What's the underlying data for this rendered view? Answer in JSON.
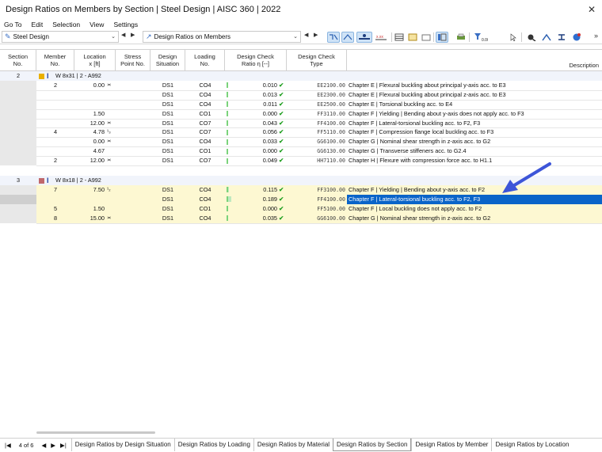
{
  "window": {
    "title": "Design Ratios on Members by Section | Steel Design | AISC 360 | 2022",
    "close": "✕"
  },
  "menu": [
    "Go To",
    "Edit",
    "Selection",
    "View",
    "Settings"
  ],
  "toolbar": {
    "module": "Steel Design",
    "table": "Design Ratios on Members",
    "more": "»"
  },
  "columns": {
    "section": [
      "Section",
      "No."
    ],
    "member": [
      "Member",
      "No."
    ],
    "location": [
      "Location",
      "x [ft]"
    ],
    "stress": [
      "Stress",
      "Point No."
    ],
    "situation": [
      "Design",
      "Situation"
    ],
    "loading": [
      "Loading",
      "No."
    ],
    "ratio": [
      "Design Check",
      "Ratio η [--]"
    ],
    "type": [
      "Design Check",
      "Type"
    ],
    "desc": "Description"
  },
  "groups": [
    {
      "section": "2",
      "color": "#e9b000",
      "name": "W 8x31 | 2 - A992",
      "rows": [
        {
          "member": "2",
          "loc": "0.00",
          "sym": "≍",
          "ds": "DS1",
          "lo": "CO4",
          "ratio": "0.010",
          "bar": 0.01,
          "type": "EE2100.00",
          "desc": "Chapter E | Flexural buckling about principal y-axis acc. to E3"
        },
        {
          "member": "",
          "loc": "",
          "sym": "",
          "ds": "DS1",
          "lo": "CO4",
          "ratio": "0.013",
          "bar": 0.013,
          "type": "EE2300.00",
          "desc": "Chapter E | Flexural buckling about principal z-axis acc. to E3"
        },
        {
          "member": "",
          "loc": "",
          "sym": "",
          "ds": "DS1",
          "lo": "CO4",
          "ratio": "0.011",
          "bar": 0.011,
          "type": "EE2500.00",
          "desc": "Chapter E | Torsional buckling acc. to E4"
        },
        {
          "member": "",
          "loc": "1.50",
          "sym": "",
          "ds": "DS1",
          "lo": "CO1",
          "ratio": "0.000",
          "bar": 0,
          "type": "FF3110.00",
          "desc": "Chapter F | Yielding | Bending about y-axis does not apply acc. to F3"
        },
        {
          "member": "",
          "loc": "12.00",
          "sym": "≍",
          "ds": "DS1",
          "lo": "CO7",
          "ratio": "0.043",
          "bar": 0.043,
          "type": "FF4100.00",
          "desc": "Chapter F | Lateral-torsional buckling acc. to F2, F3"
        },
        {
          "member": "4",
          "loc": "4.78",
          "sym": "¹₃",
          "ds": "DS1",
          "lo": "CO7",
          "ratio": "0.056",
          "bar": 0.056,
          "type": "FF5110.00",
          "desc": "Chapter F | Compression flange local buckling acc. to F3"
        },
        {
          "member": "",
          "loc": "0.00",
          "sym": "≍",
          "ds": "DS1",
          "lo": "CO4",
          "ratio": "0.033",
          "bar": 0.033,
          "type": "GG6100.00",
          "desc": "Chapter G | Nominal shear strength in z-axis acc. to G2"
        },
        {
          "member": "",
          "loc": "4.67",
          "sym": "",
          "ds": "DS1",
          "lo": "CO1",
          "ratio": "0.000",
          "bar": 0,
          "type": "GG6130.00",
          "desc": "Chapter G | Transverse stiffeners acc. to G2.4"
        },
        {
          "member": "2",
          "loc": "12.00",
          "sym": "≍",
          "ds": "DS1",
          "lo": "CO7",
          "ratio": "0.049",
          "bar": 0.049,
          "type": "HH7110.00",
          "desc": "Chapter H | Flexure with compression force acc. to H1.1"
        }
      ]
    },
    {
      "section": "3",
      "color": "#c0686c",
      "name": "W 8x18 | 2 - A992",
      "rows": [
        {
          "member": "7",
          "loc": "7.50",
          "sym": "¹₂",
          "ds": "DS1",
          "lo": "CO4",
          "ratio": "0.115",
          "bar": 0.115,
          "type": "FF3100.00",
          "desc": "Chapter F | Yielding | Bending about y-axis acc. to F2",
          "hl": true
        },
        {
          "member": "",
          "loc": "",
          "sym": "",
          "ds": "DS1",
          "lo": "CO4",
          "ratio": "0.189",
          "bar": 0.189,
          "type": "FF4100.00",
          "desc": "Chapter F | Lateral-torsional buckling acc. to F2, F3",
          "hl": true,
          "sel": true
        },
        {
          "member": "5",
          "loc": "1.50",
          "sym": "",
          "ds": "DS1",
          "lo": "CO1",
          "ratio": "0.000",
          "bar": 0,
          "type": "FF5100.00",
          "desc": "Chapter F | Local buckling does not apply acc. to F2",
          "hl": true
        },
        {
          "member": "8",
          "loc": "15.00",
          "sym": "≍",
          "ds": "DS1",
          "lo": "CO4",
          "ratio": "0.035",
          "bar": 0.035,
          "type": "GG6100.00",
          "desc": "Chapter G | Nominal shear strength in z-axis acc. to G2",
          "hl": true
        }
      ]
    }
  ],
  "pager": {
    "first": "|◀",
    "prev": "◀",
    "page": "4 of 6",
    "next": "▶",
    "last": "▶|"
  },
  "tabs": [
    "Design Ratios by Design Situation",
    "Design Ratios by Loading",
    "Design Ratios by Material",
    "Design Ratios by Section",
    "Design Ratios by Member",
    "Design Ratios by Location"
  ],
  "active_tab": 3,
  "colors": {
    "selection": "#0a64c8",
    "highlight": "#fdf8d2",
    "arrow": "#3d55d8"
  }
}
